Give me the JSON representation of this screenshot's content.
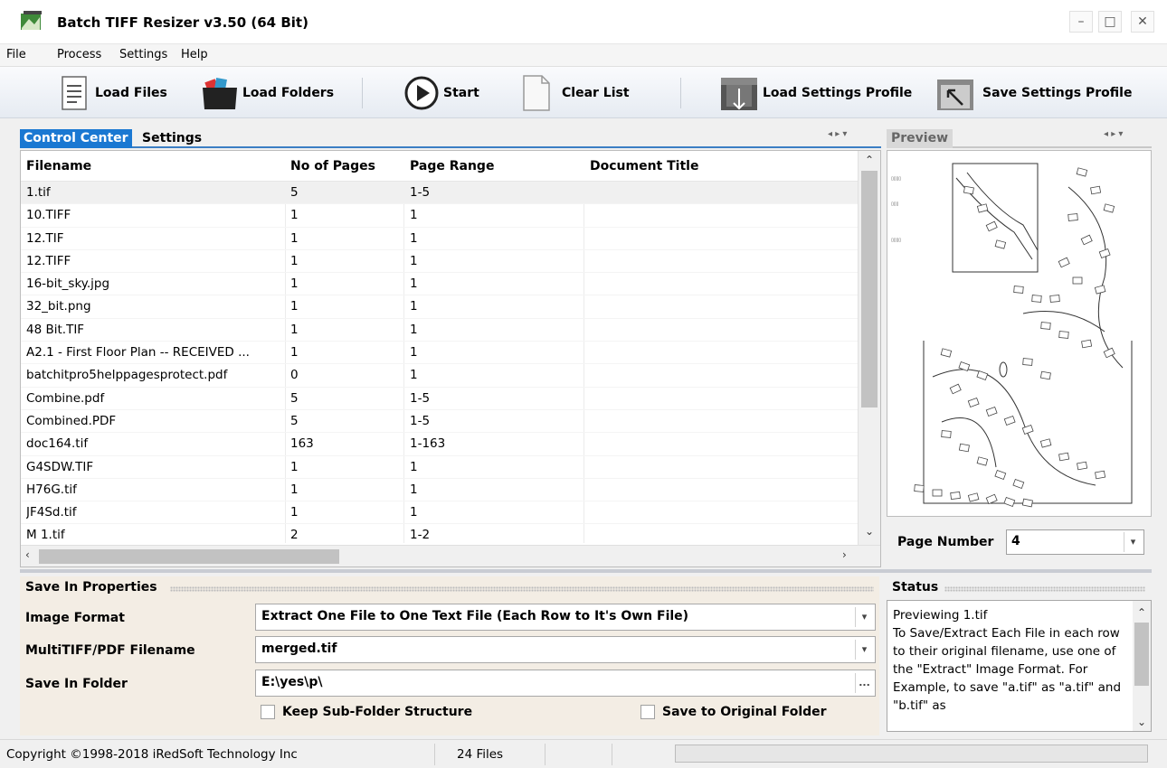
{
  "window": {
    "title": "Batch TIFF Resizer v3.50 (64 Bit)",
    "minimize": "–",
    "maximize": "□",
    "close": "✕"
  },
  "menu": [
    "File",
    "Process",
    "Settings",
    "Help"
  ],
  "toolbar": {
    "load_files": "Load Files",
    "load_folders": "Load Folders",
    "start": "Start",
    "clear_list": "Clear List",
    "load_profile": "Load Settings Profile",
    "save_profile": "Save Settings Profile"
  },
  "tabs": {
    "control_center": "Control Center",
    "settings": "Settings",
    "preview": "Preview"
  },
  "pane_arrows": "◂ ▸ ▾",
  "grid": {
    "columns": [
      "Filename",
      "No of Pages",
      "Page Range",
      "Document Title"
    ],
    "rows": [
      [
        "1.tif",
        "5",
        "1-5",
        ""
      ],
      [
        "10.TIFF",
        "1",
        "1",
        ""
      ],
      [
        "12.TIF",
        "1",
        "1",
        ""
      ],
      [
        "12.TIFF",
        "1",
        "1",
        ""
      ],
      [
        "16-bit_sky.jpg",
        "1",
        "1",
        ""
      ],
      [
        "32_bit.png",
        "1",
        "1",
        ""
      ],
      [
        "48 Bit.TIF",
        "1",
        "1",
        ""
      ],
      [
        "A2.1 - First Floor Plan -- RECEIVED ...",
        "1",
        "1",
        ""
      ],
      [
        "batchitpro5helppagesprotect.pdf",
        "0",
        "1",
        ""
      ],
      [
        "Combine.pdf",
        "5",
        "1-5",
        ""
      ],
      [
        "Combined.PDF",
        "5",
        "1-5",
        ""
      ],
      [
        "doc164.tif",
        "163",
        "1-163",
        ""
      ],
      [
        "G4SDW.TIF",
        "1",
        "1",
        ""
      ],
      [
        "H76G.tif",
        "1",
        "1",
        ""
      ],
      [
        "JF4Sd.tif",
        "1",
        "1",
        ""
      ],
      [
        "M 1.tif",
        "2",
        "1-2",
        ""
      ]
    ]
  },
  "preview": {
    "page_number_label": "Page Number",
    "page_number": "4"
  },
  "save": {
    "section_title": "Save In Properties",
    "image_format_label": "Image Format",
    "image_format": "Extract One File to One Text File (Each Row to It's Own File)",
    "multitiff_label": "MultiTIFF/PDF Filename",
    "multitiff": "merged.tif",
    "folder_label": "Save In Folder",
    "folder": "E:\\yes\\p\\",
    "browse": "...",
    "keep_subfolder": "Keep Sub-Folder Structure",
    "save_original": "Save to Original Folder"
  },
  "status": {
    "title": "Status",
    "text": "Previewing 1.tif\nTo Save/Extract Each File in each row to their original filename, use one of the \"Extract\" Image Format. For Example, to save \"a.tif\" as \"a.tif\" and \"b.tif\" as"
  },
  "statusbar": {
    "copyright": "Copyright ©1998-2018 iRedSoft Technology Inc",
    "files": "24 Files"
  },
  "colors": {
    "accent": "#1a78d2",
    "panel_bg": "#f3ede4"
  }
}
